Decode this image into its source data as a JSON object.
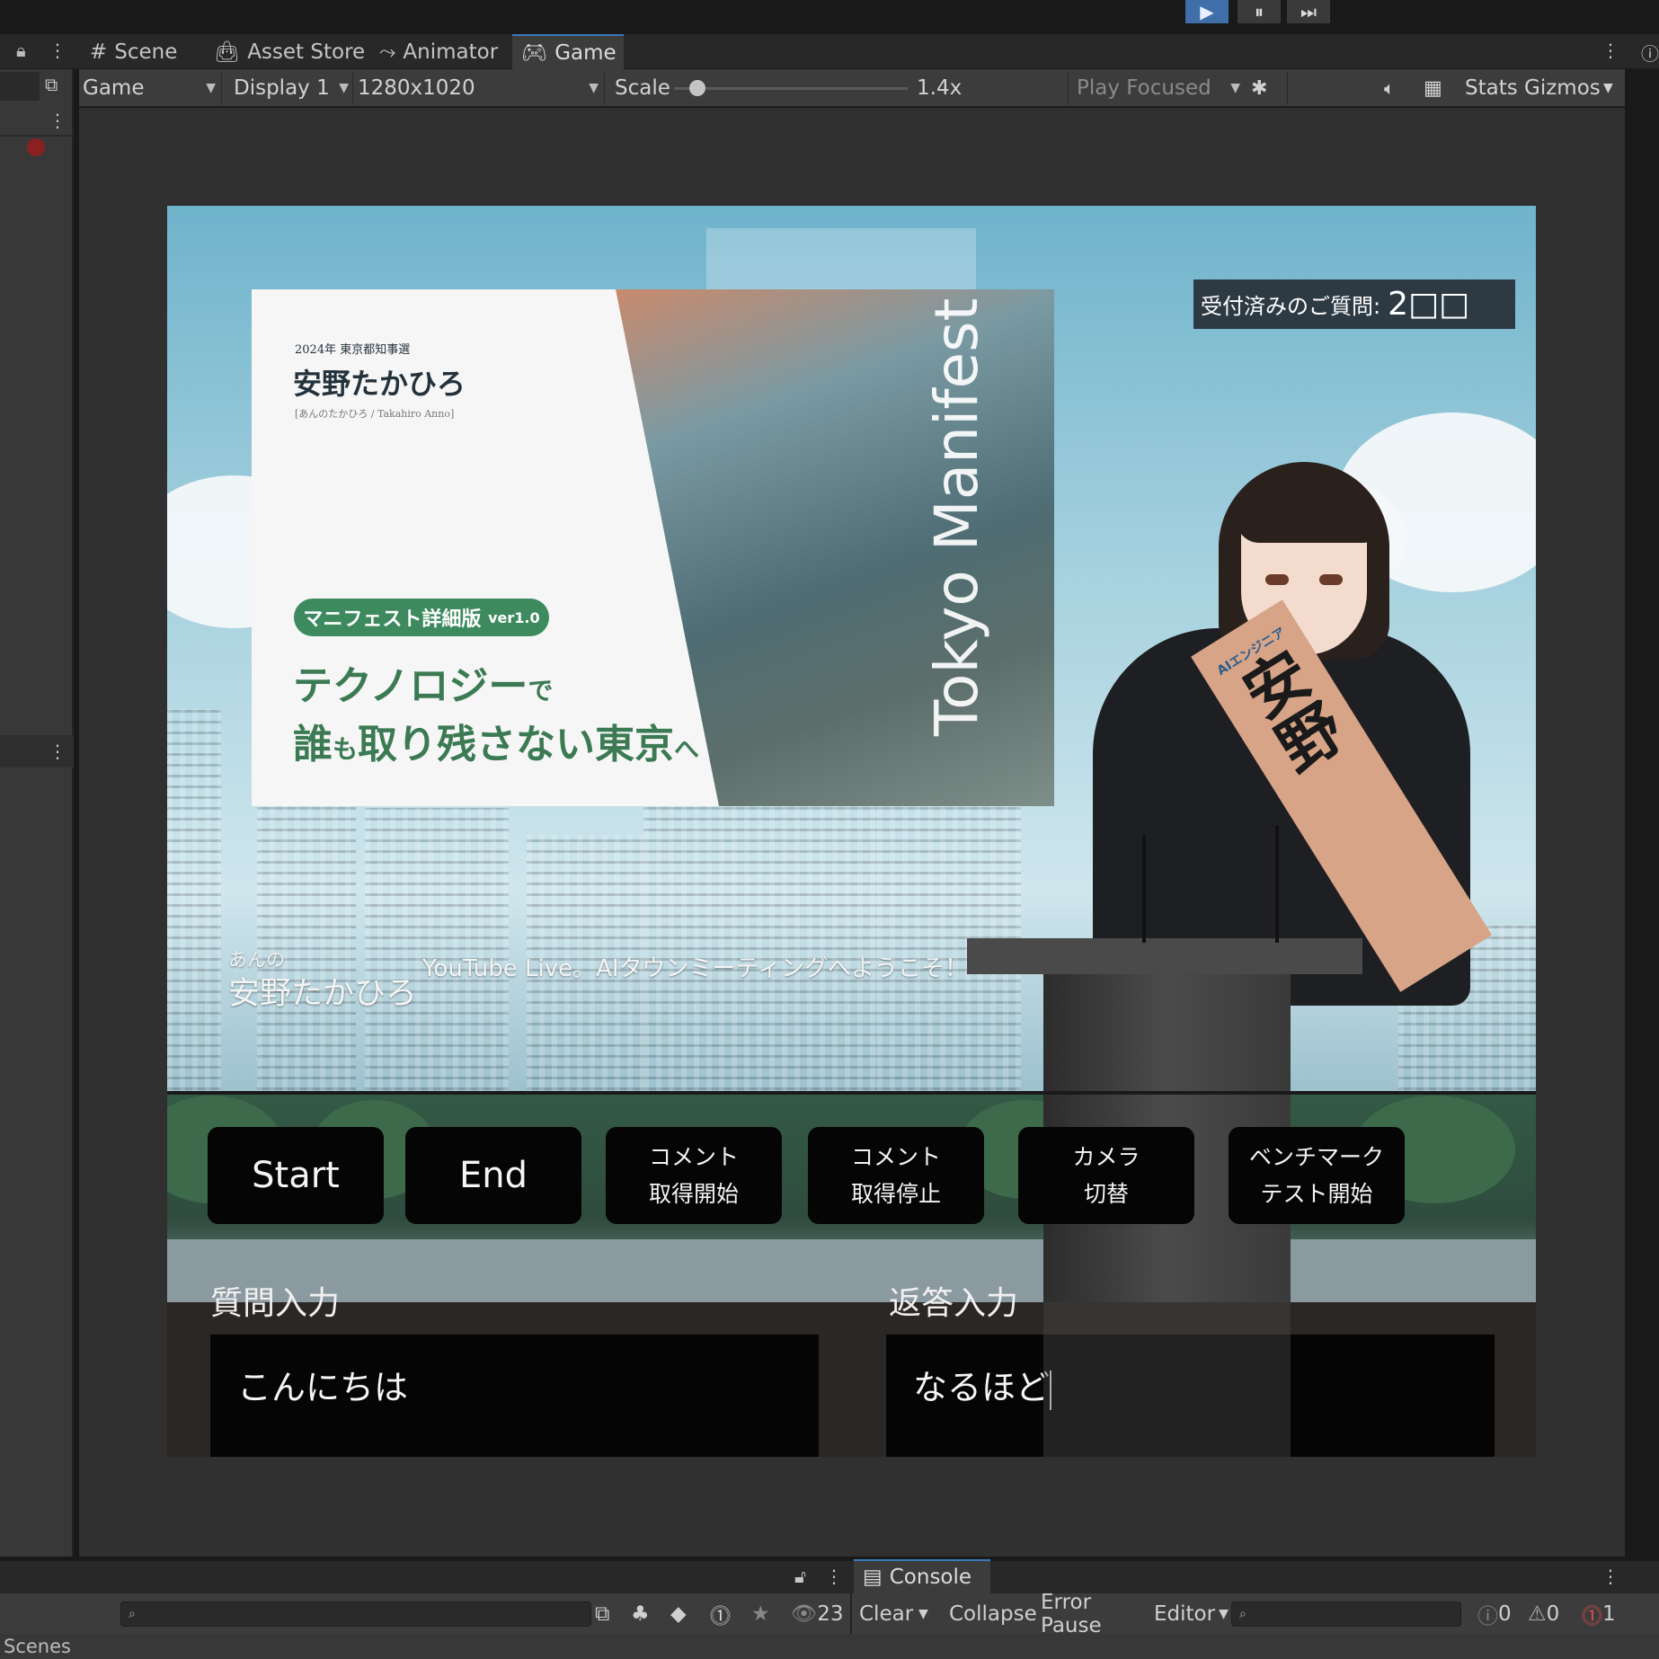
{
  "playbar": {
    "play_icon": "▶",
    "pause_icon": "⏸",
    "step_icon": "⏭"
  },
  "tabs": [
    {
      "label": "Scene",
      "icon": "#"
    },
    {
      "label": "Asset Store",
      "icon": "bag-icon"
    },
    {
      "label": "Animator",
      "icon": "animator-icon"
    },
    {
      "label": "Game",
      "icon": "gamepad-icon"
    }
  ],
  "toolbar": {
    "view_select": "Game",
    "display_select": "Display 1",
    "resolution_select": "1280x1020",
    "scale_label": "Scale",
    "scale_value": "1.4x",
    "scale_fraction": 0.1,
    "play_mode_select": "Play Focused",
    "stats_label": "Stats",
    "gizmos_label": "Gizmos"
  },
  "game": {
    "card": {
      "kicker": "2024年 東京都知事選",
      "name": "安野たかひろ",
      "name_reading": "[あんのたかひろ / Takahiro Anno]",
      "badge": "マニフェスト詳細版",
      "badge_version": "ver1.0",
      "headline_1a": "テクノロジー",
      "headline_1b": "で",
      "headline_2a": "誰",
      "headline_2b": "も",
      "headline_2c": "取り残さない東京",
      "headline_2d": "へ",
      "vertical_title": "Tokyo Manifest"
    },
    "counter_label": "受付済みのご質問:",
    "counter_value": "2□□",
    "speaker_ruby": "あんの",
    "speaker_name": "安野たかひろ",
    "message": "YouTube Live。AIタウンミーティングへようこそ！",
    "sash_text": "安野",
    "sash_sub": "AIエンジニア",
    "buttons": [
      {
        "label": "Start"
      },
      {
        "label": "End"
      },
      {
        "label": "コメント\n取得開始"
      },
      {
        "label": "コメント\n取得停止"
      },
      {
        "label": "カメラ\n切替"
      },
      {
        "label": "ベンチマーク\nテスト開始"
      }
    ],
    "question_label": "質問入力",
    "question_value": "こんにちは",
    "answer_label": "返答入力",
    "answer_value": "なるほど"
  },
  "console": {
    "tab_label": "Console",
    "hidden_count": "23",
    "clear_label": "Clear",
    "collapse_label": "Collapse",
    "error_pause_label": "Error Pause",
    "editor_label": "Editor",
    "info_count": "0",
    "warning_count": "0",
    "error_count": "1",
    "scenes_label": "Scenes"
  }
}
